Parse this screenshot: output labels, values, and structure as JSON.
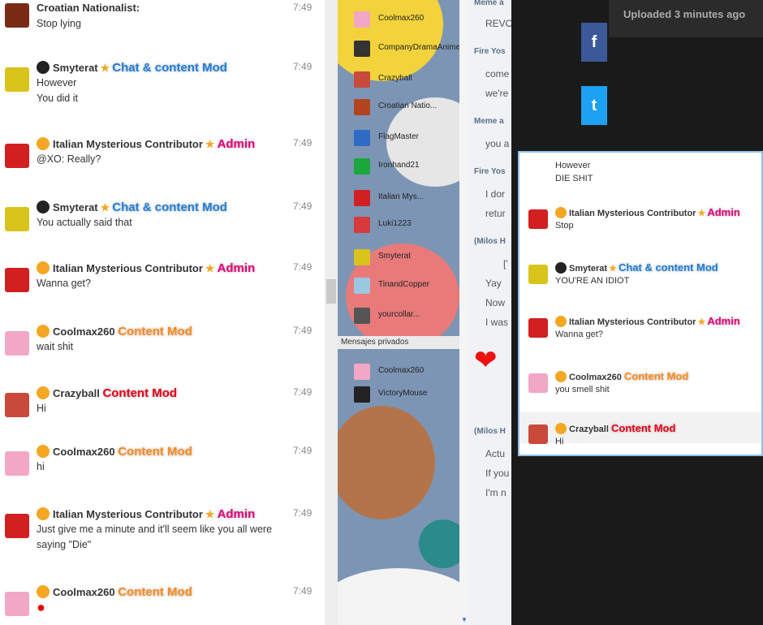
{
  "left_chat": {
    "messages": [
      {
        "user": "Croatian Nationalist:",
        "role": "",
        "badge_class": "",
        "time": "7:49",
        "lines": [
          "Stop lying"
        ],
        "avatar_color": "#7a2b16"
      },
      {
        "user": "Smyterat",
        "role": "Chat & content Mod",
        "badge_class": "b-chat",
        "star": "★",
        "time": "7:49",
        "lines": [
          "However",
          "You did it"
        ],
        "avatar_color": "#d8c41a"
      },
      {
        "user": "Italian Mysterious Contributor",
        "role": "Admin",
        "badge_class": "b-admin",
        "star": "★",
        "time": "7:49",
        "lines": [
          "@XO: Really?"
        ],
        "avatar_color": "#d21f1f"
      },
      {
        "user": "Smyterat",
        "role": "Chat & content Mod",
        "badge_class": "b-chat",
        "star": "★",
        "time": "7:49",
        "lines": [
          "You actually said that"
        ],
        "avatar_color": "#d8c41a"
      },
      {
        "user": "Italian Mysterious Contributor",
        "role": "Admin",
        "badge_class": "b-admin",
        "star": "★",
        "time": "7:49",
        "lines": [
          "Wanna get?"
        ],
        "avatar_color": "#d21f1f"
      },
      {
        "user": "Coolmax260",
        "role": "Content Mod",
        "badge_class": "b-content",
        "time": "7:49",
        "lines": [
          "wait shit"
        ],
        "avatar_color": "#f2a7c6"
      },
      {
        "user": "Crazyball",
        "role": "Content Mod",
        "badge_class": "b-crazy",
        "time": "7:49",
        "lines": [
          "Hi"
        ],
        "avatar_color": "#c94a3a"
      },
      {
        "user": "Coolmax260",
        "role": "Content Mod",
        "badge_class": "b-content",
        "time": "7:49",
        "lines": [
          "hi"
        ],
        "avatar_color": "#f2a7c6"
      },
      {
        "user": "Italian Mysterious Contributor",
        "role": "Admin",
        "badge_class": "b-admin",
        "star": "★",
        "time": "7:49",
        "lines": [
          "Just give me a minute and it'll seem like you all were",
          "saying \"Die\""
        ],
        "avatar_color": "#d21f1f"
      },
      {
        "user": "Coolmax260",
        "role": "Content Mod",
        "badge_class": "b-content",
        "time": "7:49",
        "lines": [
          "●"
        ],
        "avatar_color": "#f2a7c6"
      }
    ]
  },
  "user_list": {
    "users": [
      {
        "name": "Coolmax260",
        "color": "#f2a7c6"
      },
      {
        "name": "CompanyDramaAnime",
        "color": "#333333"
      },
      {
        "name": "Crazyball",
        "color": "#c94a3a"
      },
      {
        "name": "Croatian Natio...",
        "color": "#b24420"
      },
      {
        "name": "FlagMaster",
        "color": "#2e6bc4"
      },
      {
        "name": "Ironhand21",
        "color": "#1aa83a"
      },
      {
        "name": "Italian Mys...",
        "color": "#d21f1f"
      },
      {
        "name": "Luki1223",
        "color": "#d63a3a"
      },
      {
        "name": "Smyterat",
        "color": "#d8c41a"
      },
      {
        "name": "TinandCopper",
        "color": "#9cc7e0"
      },
      {
        "name": "yourcollar...",
        "color": "#555555"
      }
    ],
    "pm_header": "Mensajes privados",
    "pm_users": [
      {
        "name": "Coolmax260",
        "color": "#f2a7c6"
      },
      {
        "name": "VictoryMouse",
        "color": "#222222"
      }
    ]
  },
  "partial_chat": {
    "names": [
      "Meme a",
      "Fire Yos",
      "Meme a",
      "Fire Yos",
      "(Milos H",
      "(Milos H"
    ],
    "lines": [
      "REVO",
      "come",
      "we're",
      "you a",
      "I dor",
      "retur",
      "['",
      "Yay",
      "Now",
      "I was",
      "Actu",
      "If you",
      "I'm n"
    ]
  },
  "dark": {
    "uploaded": "Uploaded 3 minutes ago",
    "share": [
      {
        "icon": "f",
        "name": "facebook-icon",
        "color": "#3b5998"
      },
      {
        "icon": "t",
        "name": "twitter-icon",
        "color": "#1da1f2"
      }
    ]
  },
  "popup": {
    "messages": [
      {
        "user": "",
        "role": "",
        "badge_class": "",
        "lines": [
          "However",
          "DIE SHIT"
        ],
        "avatar_color": ""
      },
      {
        "user": "Italian Mysterious Contributor",
        "role": "Admin",
        "badge_class": "b-admin",
        "star": "★",
        "lines": [
          "Stop"
        ],
        "avatar_color": "#d21f1f"
      },
      {
        "user": "Smyterat",
        "role": "Chat & content Mod",
        "badge_class": "b-chat",
        "star": "★",
        "lines": [
          "YOU'RE AN IDIOT"
        ],
        "avatar_color": "#d8c41a"
      },
      {
        "user": "Italian Mysterious Contributor",
        "role": "Admin",
        "badge_class": "b-admin",
        "star": "★",
        "lines": [
          "Wanna get?"
        ],
        "avatar_color": "#d21f1f"
      },
      {
        "user": "Coolmax260",
        "role": "Content Mod",
        "badge_class": "b-content",
        "lines": [
          "you smell shit"
        ],
        "avatar_color": "#f2a7c6"
      },
      {
        "user": "Crazyball",
        "role": "Content Mod",
        "badge_class": "b-crazy",
        "lines": [
          "Hi"
        ],
        "avatar_color": "#c94a3a"
      }
    ]
  }
}
